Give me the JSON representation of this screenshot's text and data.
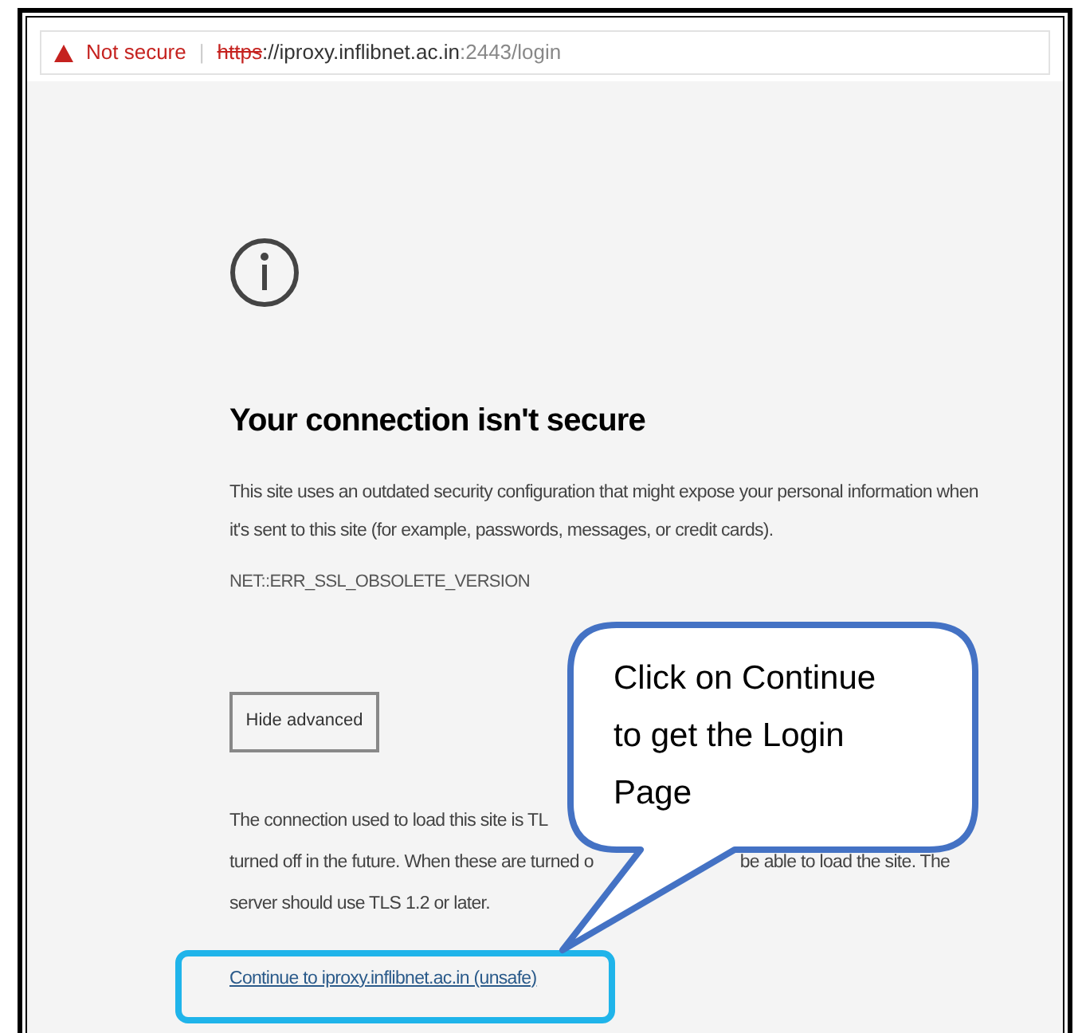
{
  "address_bar": {
    "security_label": "Not secure",
    "separator": "|",
    "scheme": "https",
    "url_rest": "://iproxy.inflibnet.ac.in",
    "port_path": ":2443/login"
  },
  "error": {
    "title": "Your connection isn't secure",
    "description": "This site uses an outdated security configuration that might expose your personal information when it's sent to this site (for example, passwords, messages, or credit cards).",
    "code": "NET::ERR_SSL_OBSOLETE_VERSION",
    "button": "Hide advanced",
    "details_lines": [
      [
        "The connection used to load this site is TL"
      ],
      [
        "turned off in the future. When these are turned o",
        "be able to load the site. The"
      ],
      [
        "server should use TLS 1.2 or later."
      ]
    ],
    "link": "Continue to iproxy.inflibnet.ac.in (unsafe)"
  },
  "callout": {
    "text": "Click on Continue to get the Login Page"
  }
}
